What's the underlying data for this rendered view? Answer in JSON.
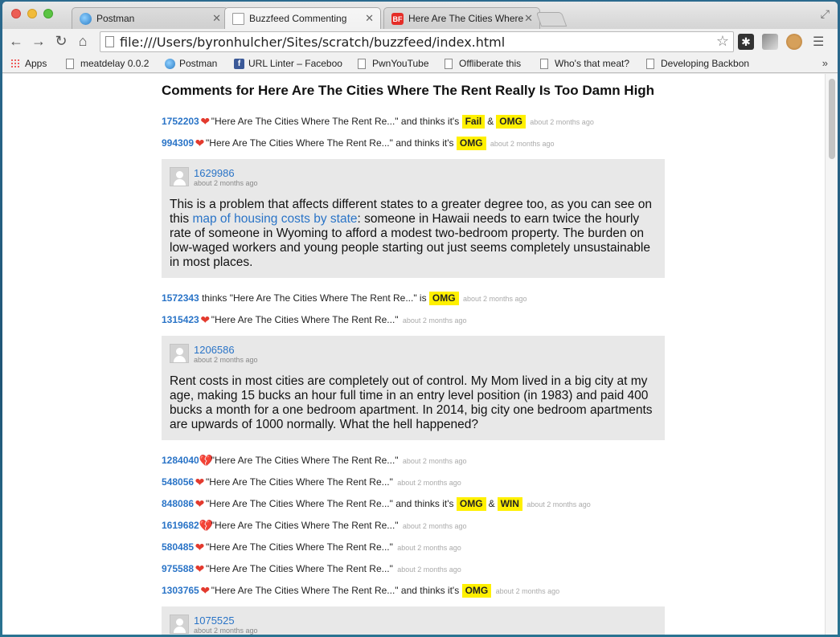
{
  "browser": {
    "tabs": [
      {
        "title": "Postman",
        "favicon": "globe-icon",
        "active": false
      },
      {
        "title": "Buzzfeed Commenting",
        "favicon": "document-icon",
        "active": true
      },
      {
        "title": "Here Are The Cities Where",
        "favicon": "buzzfeed-icon",
        "favicon_text": "BF",
        "active": false
      }
    ],
    "url": "file:///Users/byronhulcher/Sites/scratch/buzzfeed/index.html",
    "bookmarks": [
      "Apps",
      "meatdelay 0.0.2",
      "Postman",
      "URL Linter – Faceboo",
      "PwnYouTube",
      "Offliberate this",
      "Who's that meat?",
      "Developing Backbon"
    ],
    "more": "»"
  },
  "page": {
    "title_prefix": "Comments for ",
    "title_article": "Here Are The Cities Where The Rent Really Is Too Damn High"
  },
  "colors": {
    "link": "#2a74c7",
    "badge": "#fff000",
    "heart": "#e33a2e",
    "comment_bg": "#e8e8e8"
  },
  "feed": [
    {
      "type": "reaction",
      "user": "1752203",
      "heart": "red",
      "text": "\"Here Are The Cities Where The Rent Re...\" and thinks it's",
      "badges": [
        "Fail",
        "OMG"
      ],
      "time": "about 2 months ago"
    },
    {
      "type": "reaction",
      "user": "994309",
      "heart": "red",
      "text": "\"Here Are The Cities Where The Rent Re...\" and thinks it's",
      "badges": [
        "OMG"
      ],
      "time": "about 2 months ago"
    },
    {
      "type": "comment",
      "user": "1629986",
      "time": "about 2 months ago",
      "body_before": "This is a problem that affects different states to a greater degree too, as you can see on this ",
      "link": "map of housing costs by state",
      "body_after": ": someone in Hawaii needs to earn twice the hourly rate of someone in Wyoming to afford a modest two-bedroom property. The burden on low-waged workers and young people starting out just seems completely unsustainable in most places."
    },
    {
      "type": "reaction",
      "user": "1572343",
      "heart": "none",
      "text": "thinks \"Here Are The Cities Where The Rent Re...\" is",
      "badges": [
        "OMG"
      ],
      "time": "about 2 months ago"
    },
    {
      "type": "reaction",
      "user": "1315423",
      "heart": "red",
      "text": "\"Here Are The Cities Where The Rent Re...\"",
      "badges": [],
      "time": "about 2 months ago"
    },
    {
      "type": "comment",
      "user": "1206586",
      "time": "about 2 months ago",
      "body_before": "Rent costs in most cities are completely out of control. My Mom lived in a big city at my age, making 15 bucks an hour full time in an entry level position (in 1983) and paid 400 bucks a month for a one bedroom apartment. In 2014, big city one bedroom apartments are upwards of 1000 normally. What the hell happened?",
      "link": "",
      "body_after": ""
    },
    {
      "type": "reaction",
      "user": "1284040",
      "heart": "black",
      "text": "\"Here Are The Cities Where The Rent Re...\"",
      "badges": [],
      "time": "about 2 months ago"
    },
    {
      "type": "reaction",
      "user": "548056",
      "heart": "red",
      "text": "\"Here Are The Cities Where The Rent Re...\"",
      "badges": [],
      "time": "about 2 months ago"
    },
    {
      "type": "reaction",
      "user": "848086",
      "heart": "red",
      "text": "\"Here Are The Cities Where The Rent Re...\" and thinks it's",
      "badges": [
        "OMG",
        "WIN"
      ],
      "time": "about 2 months ago"
    },
    {
      "type": "reaction",
      "user": "1619682",
      "heart": "black",
      "text": "\"Here Are The Cities Where The Rent Re...\"",
      "badges": [],
      "time": "about 2 months ago"
    },
    {
      "type": "reaction",
      "user": "580485",
      "heart": "red",
      "text": "\"Here Are The Cities Where The Rent Re...\"",
      "badges": [],
      "time": "about 2 months ago"
    },
    {
      "type": "reaction",
      "user": "975588",
      "heart": "red",
      "text": "\"Here Are The Cities Where The Rent Re...\"",
      "badges": [],
      "time": "about 2 months ago"
    },
    {
      "type": "reaction",
      "user": "1303765",
      "heart": "red",
      "text": "\"Here Are The Cities Where The Rent Re...\" and thinks it's",
      "badges": [
        "OMG"
      ],
      "time": "about 2 months ago"
    },
    {
      "type": "comment",
      "user": "1075525",
      "time": "about 2 months ago",
      "body_before": "",
      "link": "",
      "body_after": ""
    }
  ]
}
